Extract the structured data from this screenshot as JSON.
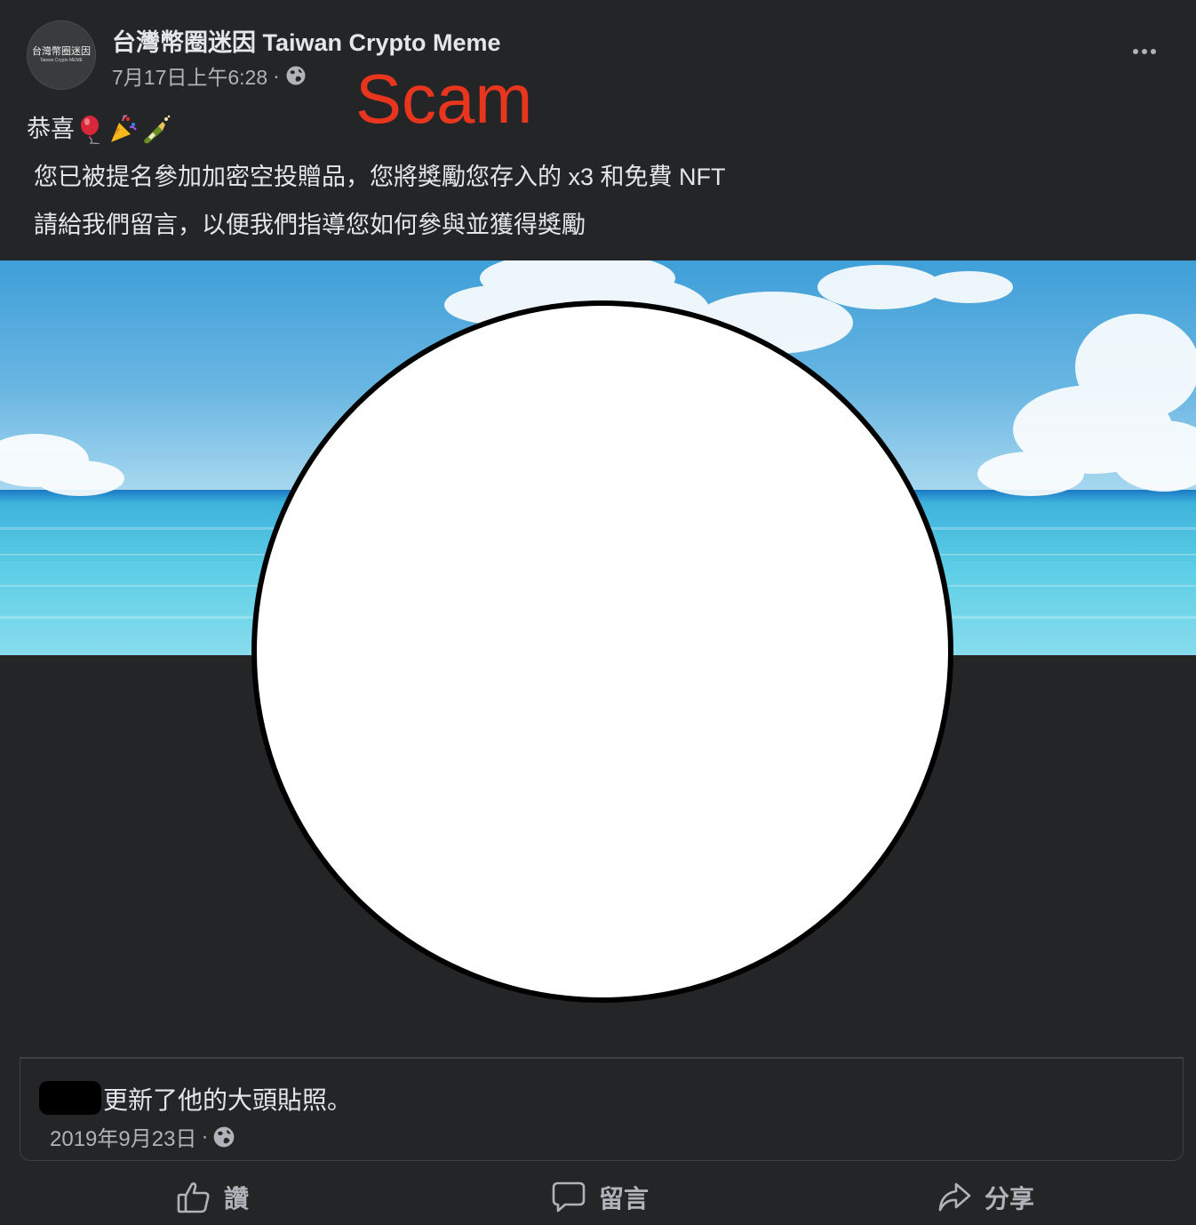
{
  "post": {
    "avatar_text_line1": "台灣幣圈迷因",
    "avatar_text_line2": "Taiwan Crypto MEME",
    "page_name": "台灣幣圈迷因 Taiwan Crypto Meme",
    "timestamp": "7月17日上午6:28",
    "separator": "·",
    "privacy_icon": "globe-icon",
    "annotation": "Scam",
    "annotation_color": "#e8361e",
    "text_line1": "恭喜",
    "text_line1_emojis": [
      "balloon-emoji",
      "party-popper-emoji",
      "champagne-emoji"
    ],
    "text_line2": "您已被提名參加加密空投贈品，您將獎勵您存入的 x3 和免費 NFT",
    "text_line3": "請給我們留言，以便我們指導您如何參與並獲得獎勵"
  },
  "shared_update": {
    "update_text": "更新了他的大頭貼照。",
    "date": "2019年9月23日",
    "separator": "·",
    "privacy_icon": "globe-icon"
  },
  "actions": {
    "like_label": "讚",
    "comment_label": "留言",
    "share_label": "分享"
  },
  "colors": {
    "background": "#242526",
    "text_primary": "#e4e6eb",
    "text_secondary": "#b0b3b8"
  }
}
